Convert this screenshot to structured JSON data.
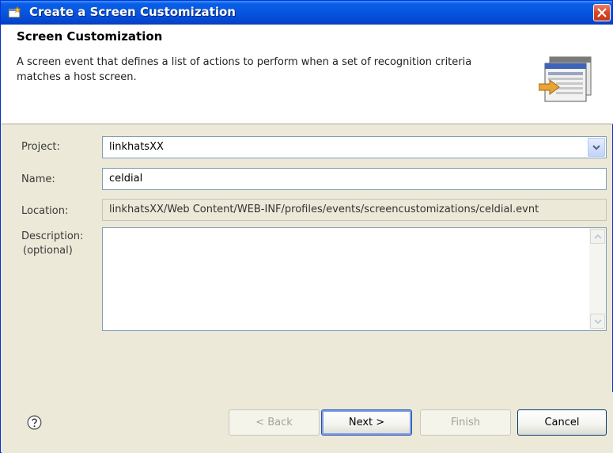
{
  "window": {
    "title": "Create a Screen Customization"
  },
  "banner": {
    "title": "Screen Customization",
    "description": "A screen event that defines a list of actions to perform when a set of recognition criteria matches a host screen."
  },
  "form": {
    "project_label": "Project:",
    "project_value": "linkhatsXX",
    "name_label": "Name:",
    "name_value": "celdial",
    "location_label": "Location:",
    "location_value": "linkhatsXX/Web Content/WEB-INF/profiles/events/screencustomizations/celdial.evnt",
    "description_label_1": "Description:",
    "description_label_2": "(optional)",
    "description_value": ""
  },
  "footer": {
    "back_label": "< Back",
    "next_label": "Next >",
    "finish_label": "Finish",
    "cancel_label": "Cancel"
  },
  "icons": {
    "title": "wizard-icon",
    "close": "close-icon",
    "banner": "screen-customization-graphic",
    "help": "help-icon",
    "combo": "chevron-down-icon"
  },
  "colors": {
    "titlebar": "#0655e0",
    "close_button": "#d6482a",
    "dialog_background": "#ece9d8",
    "field_border": "#7f9db9"
  }
}
